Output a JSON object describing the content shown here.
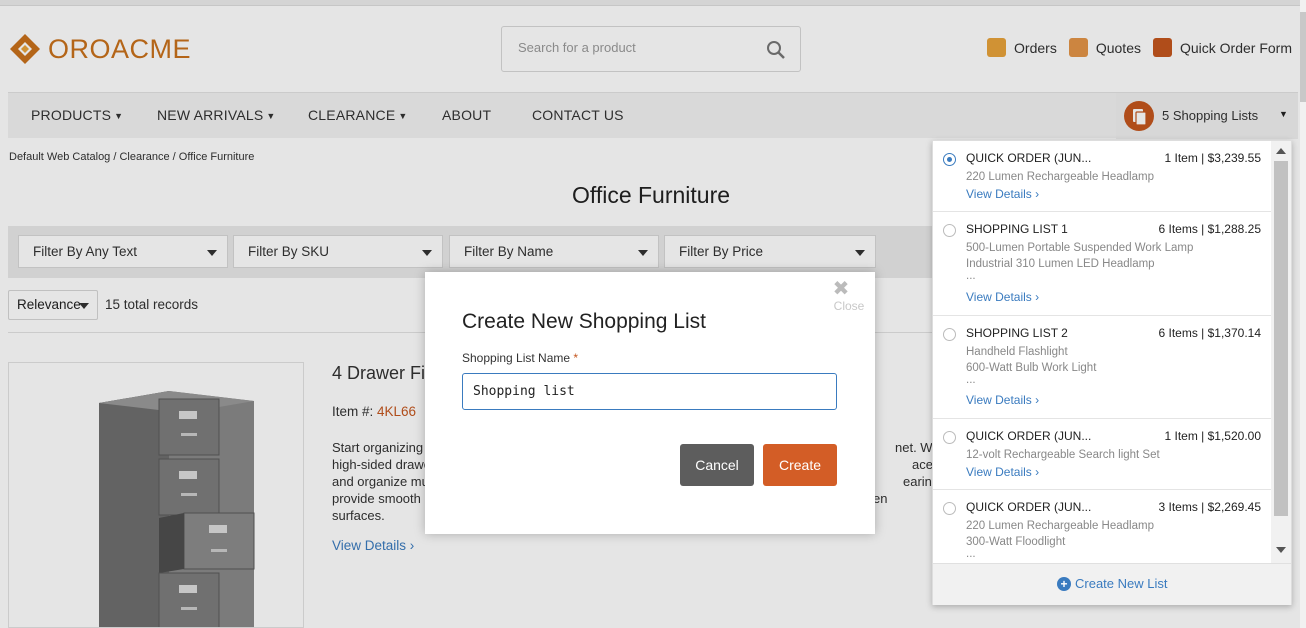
{
  "brand": {
    "name_part1": "ORO",
    "name_part2": "ACME",
    "accent": "#c9711b"
  },
  "search": {
    "placeholder": "Search for a product",
    "icon": "search-icon"
  },
  "top_links": [
    {
      "label": "Orders",
      "icon": "orders-icon",
      "color": "#e8a33a"
    },
    {
      "label": "Quotes",
      "icon": "quotes-icon",
      "color": "#e49548"
    },
    {
      "label": "Quick Order Form",
      "icon": "quick-order-icon",
      "color": "#c4561e"
    }
  ],
  "nav": {
    "items": [
      "PRODUCTS",
      "NEW ARRIVALS",
      "CLEARANCE",
      "ABOUT",
      "CONTACT US"
    ],
    "shopping_lists_label": "5 Shopping Lists"
  },
  "breadcrumb": "Default Web Catalog / Clearance / Office Furniture",
  "page_title": "Office Furniture",
  "filters": [
    "Filter By Any Text",
    "Filter By SKU",
    "Filter By Name",
    "Filter By Price"
  ],
  "sort": {
    "selected": "Relevance"
  },
  "records": "15 total records",
  "product": {
    "title": "4 Drawer Fi",
    "item_label": "Item #:",
    "sku": "4KL66",
    "desc_lines": [
      "Start organizing",
      "high-sided drawe",
      "and organize mu",
      "provide smooth",
      "surfaces."
    ],
    "desc_right": [
      "net. With",
      "ace to sto",
      "earings to",
      "en"
    ],
    "view_details": "View Details ›"
  },
  "shopping_lists": [
    {
      "name": "QUICK ORDER (JUN...",
      "summary": "1 Item | $3,239.55",
      "lines": [
        "220 Lumen Rechargeable Headlamp"
      ],
      "more": false,
      "selected": true
    },
    {
      "name": "SHOPPING LIST 1",
      "summary": "6 Items | $1,288.25",
      "lines": [
        "500-Lumen Portable Suspended Work Lamp",
        "Industrial 310 Lumen LED Headlamp"
      ],
      "more": true,
      "selected": false
    },
    {
      "name": "SHOPPING LIST 2",
      "summary": "6 Items | $1,370.14",
      "lines": [
        "Handheld Flashlight",
        "600-Watt Bulb Work Light"
      ],
      "more": true,
      "selected": false
    },
    {
      "name": "QUICK ORDER (JUN...",
      "summary": "1 Item | $1,520.00",
      "lines": [
        "12-volt Rechargeable Search light Set"
      ],
      "more": false,
      "selected": false
    },
    {
      "name": "QUICK ORDER (JUN...",
      "summary": "3 Items | $2,269.45",
      "lines": [
        "220 Lumen Rechargeable Headlamp",
        "300-Watt Floodlight"
      ],
      "more": true,
      "selected": false
    }
  ],
  "sl_view_details": "View Details ›",
  "sl_more": "...",
  "create_new_list": "Create New List",
  "modal": {
    "close_label": "Close",
    "title": "Create New Shopping List",
    "field_label": "Shopping List Name",
    "required_mark": "*",
    "input_value": "Shopping list",
    "cancel": "Cancel",
    "create": "Create"
  }
}
